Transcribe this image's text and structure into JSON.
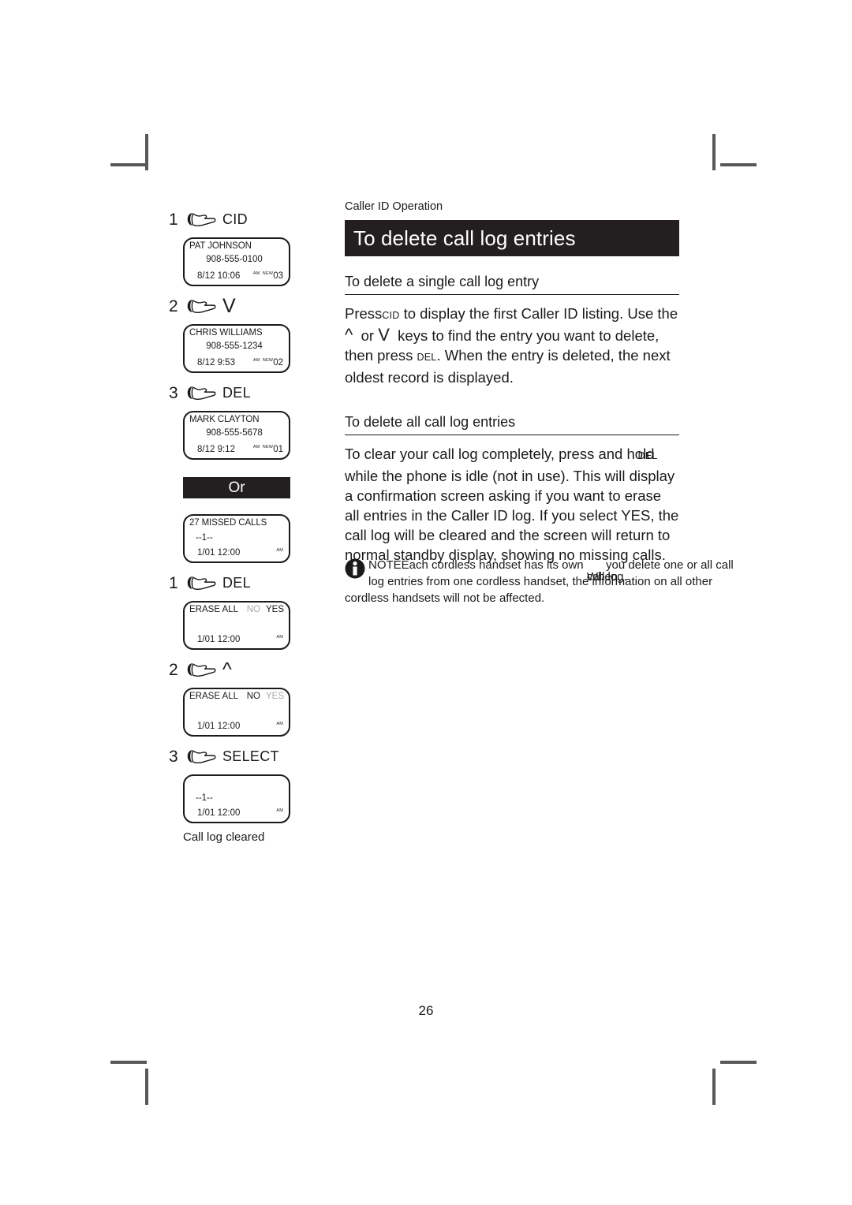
{
  "document": {
    "running_head": "Caller ID Operation",
    "page_number": "26",
    "title": "To delete call log entries"
  },
  "sections": [
    {
      "heading": "To delete a single call log entry",
      "paragraph_parts": {
        "p1": "Press",
        "key1": "CID",
        "p2": " to display the first Caller ID listing. Use the ",
        "key_up": "^",
        "p3": " or ",
        "key_down": "V",
        "p4": " keys to find the entry you want to delete, then press ",
        "key2": "DEL",
        "p5": ". When the entry is deleted, the next oldest record is displayed."
      }
    },
    {
      "heading": "To delete all call log entries",
      "paragraph_parts": {
        "p1": "To clear your call log completely, press and hold ",
        "key1": "DEL",
        "p2": " while the phone is idle (not in use). This will display a confirmation screen asking if you want to erase all entries in the Caller ID log. If you select YES, the call log will be cleared and the screen will return to normal standby display, showing no missing calls."
      }
    }
  ],
  "note": {
    "label": "NOTE",
    "part1": "Each cordless handset has its own ",
    "overlap_a": "call log.",
    "overlap_b": "When",
    "part2": " you delete one or all call log entries from one cordless handset, the information on all other cordless handsets will not be affected."
  },
  "steps_single": [
    {
      "num": "1",
      "key": "CID",
      "arrow": false
    },
    {
      "num": "2",
      "key": "V",
      "arrow": true
    },
    {
      "num": "3",
      "key": "DEL",
      "arrow": false
    }
  ],
  "steps_all": [
    {
      "num": "1",
      "key": "DEL",
      "arrow": false
    },
    {
      "num": "2",
      "key": "^",
      "arrow": true
    },
    {
      "num": "3",
      "key": "SELECT",
      "arrow": false
    }
  ],
  "or_label": "Or",
  "caption": "Call log cleared",
  "screens": {
    "pat": {
      "name": "PAT JOHNSON",
      "number": "908-555-0100",
      "date": "8/12 10:06",
      "flag_am": "AM",
      "flag_new": "NEW",
      "record": "03"
    },
    "chris": {
      "name": "CHRIS WILLIAMS",
      "number": "908-555-1234",
      "date": "8/12 9:53",
      "flag_am": "AM",
      "flag_new": "NEW",
      "record": "02"
    },
    "mark": {
      "name": "MARK CLAYTON",
      "number": "908-555-5678",
      "date": "8/12 9:12",
      "flag_am": "AM",
      "flag_new": "NEW",
      "record": "01"
    },
    "missed": {
      "name": "27 MISSED CALLS",
      "handset": "--1--",
      "date": "1/01  12:00",
      "flag_am": "AM"
    },
    "erase_yes": {
      "label": "ERASE ALL",
      "no": "NO",
      "yes": "YES",
      "date": "1/01  12:00",
      "flag_am": "AM"
    },
    "erase_no": {
      "label": "ERASE ALL",
      "no": "NO",
      "yes": "YES",
      "date": "1/01  12:00",
      "flag_am": "AM"
    },
    "cleared": {
      "handset": "--1--",
      "date": "1/01  12:00",
      "flag_am": "AM"
    }
  },
  "colors": {
    "banner_bg": "#231f20",
    "text": "#1a1a1a",
    "dim_option": "#a8a8a8",
    "crop_mark": "#58585a"
  }
}
